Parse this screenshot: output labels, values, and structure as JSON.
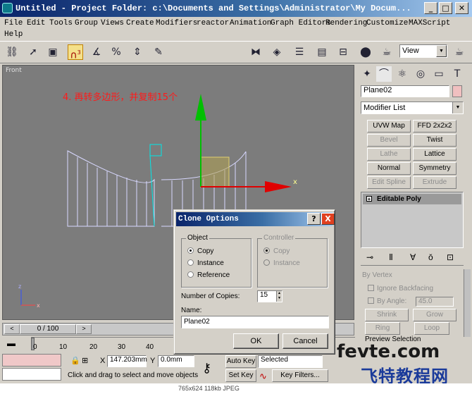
{
  "window": {
    "title": "Untitled    - Project Folder: c:\\Documents and Settings\\Administrator\\My Docum..."
  },
  "menu": [
    "File",
    "Edit",
    "Tools",
    "Group",
    "Views",
    "Create",
    "Modifiers",
    "reactor",
    "Animation",
    "Graph Editors",
    "Rendering",
    "Customize",
    "MAXScript",
    "Help"
  ],
  "toolbar": {
    "view_combo": "View",
    "tb_badge": "3"
  },
  "viewport": {
    "label": "Front",
    "annotation": "4. 再转多边形，并复制15个",
    "axis_x": "x",
    "axis_z": "z"
  },
  "panel": {
    "object_name": "Plane02",
    "modifier_list": "Modifier List",
    "buttons": [
      "UVW Map",
      "FFD 2x2x2",
      "Bevel",
      "Twist",
      "Lathe",
      "Lattice",
      "Normal",
      "Symmetry",
      "Edit Spline",
      "Extrude"
    ],
    "stack_item": "Editable Poly",
    "lower": {
      "by_vertex": "By Vertex",
      "ignore_backfacing": "Ignore Backfacing",
      "by_angle": "By Angle:",
      "angle_value": "45.0",
      "shrink": "Shrink",
      "grow": "Grow",
      "ring": "Ring",
      "loop": "Loop",
      "preview": "Preview Selection"
    }
  },
  "timeline": {
    "frame": "0 / 100",
    "ticks": [
      "0",
      "10",
      "20",
      "30",
      "40"
    ]
  },
  "status": {
    "lock": "X",
    "x_value": "147.203mm",
    "y_label": "Y",
    "y_value": "0.0mm",
    "hint": "Click and drag to select and move objects",
    "auto_key": "Auto Key",
    "set_key": "Set Key",
    "selected": "Selected",
    "key_filters": "Key Filters..."
  },
  "dialog": {
    "title": "Clone Options",
    "help": "?",
    "close": "X",
    "object_group": "Object",
    "object_options": [
      "Copy",
      "Instance",
      "Reference"
    ],
    "controller_group": "Controller",
    "controller_options": [
      "Copy",
      "Instance"
    ],
    "copies_label": "Number of Copies:",
    "copies_value": "15",
    "name_label": "Name:",
    "name_value": "Plane02",
    "ok": "OK",
    "cancel": "Cancel"
  },
  "caption": "765x624  118kb  JPEG",
  "watermark": {
    "site": "fevte.com",
    "cn": "飞特教程网"
  },
  "colors": {
    "title_bar": "#0a246a",
    "viewport": "#7c7c7c",
    "mesh": "#d8d8ff",
    "gizmo_y": "#00c000",
    "gizmo_x": "#e00000",
    "annotation": "#ff1a1a"
  }
}
